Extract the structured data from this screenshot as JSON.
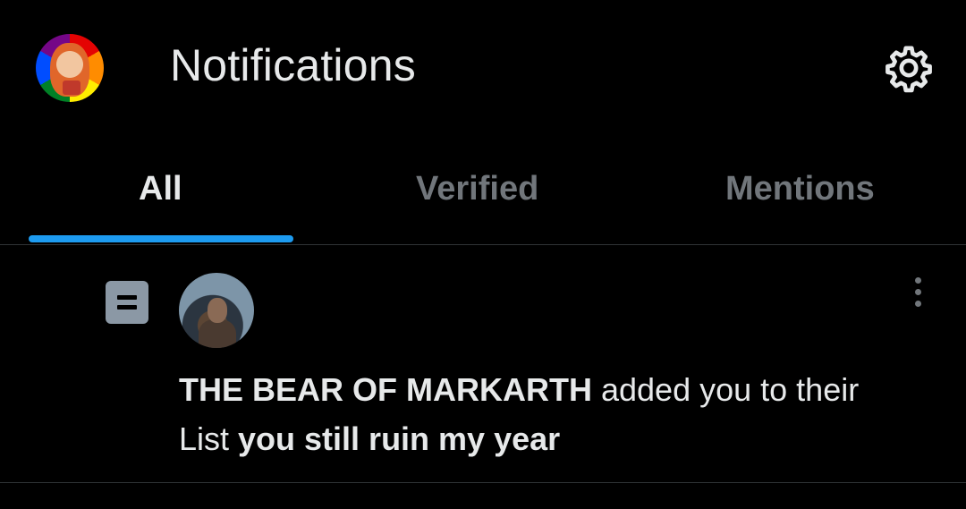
{
  "header": {
    "title": "Notifications",
    "avatar_icon": "profile-avatar",
    "settings_icon": "gear-icon"
  },
  "tabs": [
    {
      "label": "All",
      "active": true
    },
    {
      "label": "Verified",
      "active": false
    },
    {
      "label": "Mentions",
      "active": false
    }
  ],
  "notification": {
    "type_icon": "list-icon",
    "user_name": "THE BEAR OF MARKARTH",
    "action_text": " added you to their List ",
    "list_name": "you still ruin my year",
    "more_icon": "more-vertical-icon"
  },
  "colors": {
    "background": "#000000",
    "text_primary": "#e7e9ea",
    "text_secondary": "#71767b",
    "accent": "#1d9bf0",
    "divider": "#2f3336"
  }
}
